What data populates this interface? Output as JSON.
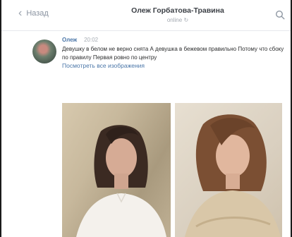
{
  "header": {
    "back_label": "Назад",
    "title": "Олеж Горбатова-Травина",
    "subtitle": "online"
  },
  "message": {
    "author": "Олеж",
    "time": "20:02",
    "text": "Девушку в белом не верно снята А девушка в бежевом правильно Потому что сбоку по правилу Первая ровно по центру",
    "link": "Посмотреть все изображения"
  },
  "icons": {
    "back": "chevron-left-icon",
    "search": "search-icon",
    "sync": "sync-icon"
  },
  "colors": {
    "link": "#4a76a8",
    "muted": "#8a93a0"
  }
}
